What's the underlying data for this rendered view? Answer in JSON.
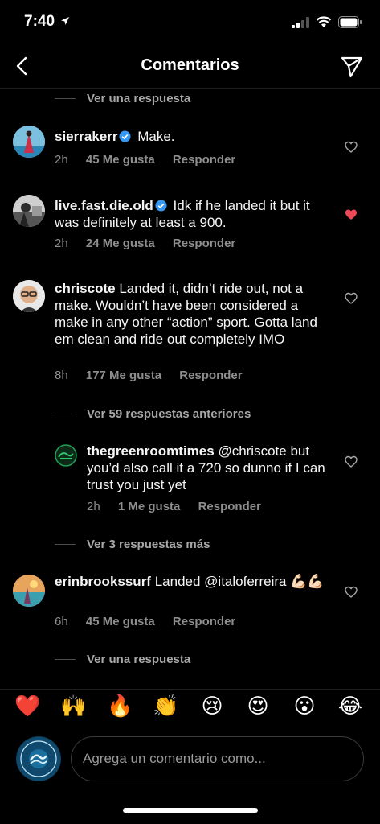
{
  "status_bar": {
    "time": "7:40"
  },
  "header": {
    "title": "Comentarios"
  },
  "view_replies": [
    "Ver una respuesta",
    "Ver 59 respuestas anteriores",
    "Ver 3 respuestas más",
    "Ver una respuesta"
  ],
  "comments": [
    {
      "user": "sierrakerr",
      "verified": true,
      "text": "Make.",
      "time": "2h",
      "likes": "45 Me gusta",
      "reply": "Responder",
      "liked": false
    },
    {
      "user": "live.fast.die.old",
      "verified": true,
      "text": "Idk if he landed it but it was definitely at least a 900.",
      "time": "2h",
      "likes": "24 Me gusta",
      "reply": "Responder",
      "liked": true
    },
    {
      "user": "chriscote",
      "verified": false,
      "text": "Landed it, didn’t ride out, not a make. Wouldn’t have been considered a make in any other “action” sport. Gotta land em clean and ride out completely IMO",
      "time": "8h",
      "likes": "177 Me gusta",
      "reply": "Responder",
      "liked": false
    },
    {
      "user": "thegreenroomtimes",
      "verified": false,
      "text": "@chriscote but you’d also call it a 720 so dunno if I can trust you just yet",
      "time": "2h",
      "likes": "1 Me gusta",
      "reply": "Responder",
      "liked": false
    },
    {
      "user": "erinbrookssurf",
      "verified": false,
      "text": "Landed @italoferreira 💪🏻💪🏻",
      "time": "6h",
      "likes": "45 Me gusta",
      "reply": "Responder",
      "liked": false
    }
  ],
  "reactions": [
    "❤️",
    "🙌",
    "🔥",
    "👏",
    "😢",
    "😍",
    "😮",
    "😂"
  ],
  "composer": {
    "placeholder": "Agrega un comentario como..."
  },
  "colors": {
    "like_red": "#ed4956",
    "verified_blue": "#3897f0"
  }
}
